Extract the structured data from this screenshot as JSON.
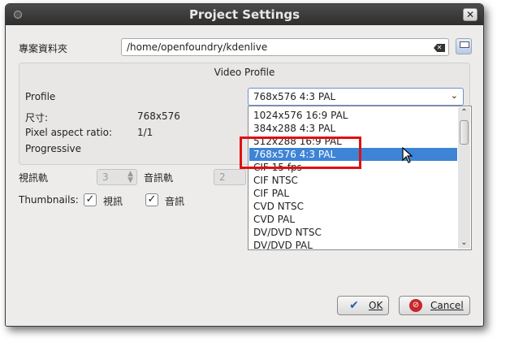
{
  "window": {
    "title": "Project Settings",
    "close_label": "✕"
  },
  "folder": {
    "label": "專案資料夾",
    "path": "/home/openfoundry/kdenlive"
  },
  "video_profile": {
    "group_title": "Video Profile",
    "profile_label": "Profile",
    "profile_value": "768x576 4:3 PAL",
    "size_label": "尺寸:",
    "size_value": "768x576",
    "par_label": "Pixel aspect ratio:",
    "par_value": "1/1",
    "progressive_label": "Progressive"
  },
  "tracks": {
    "video_label": "視訊軌",
    "video_count": "3",
    "audio_label": "音訊軌",
    "audio_count": "2"
  },
  "thumbnails": {
    "label": "Thumbnails:",
    "video_label": "視訊",
    "audio_label": "音訊"
  },
  "dropdown": {
    "items": [
      "1024x576 16:9 PAL",
      "384x288 4:3 PAL",
      "512x288 16:9 PAL",
      "768x576 4:3 PAL",
      "CIF 15 fps",
      "CIF NTSC",
      "CIF PAL",
      "CVD NTSC",
      "CVD PAL",
      "DV/DVD NTSC",
      "DV/DVD PAL"
    ],
    "selected_index": 3
  },
  "buttons": {
    "ok_label": "OK",
    "cancel_label": "Cancel"
  },
  "colors": {
    "highlight": "#3e84d6",
    "annotation": "#e01010"
  }
}
